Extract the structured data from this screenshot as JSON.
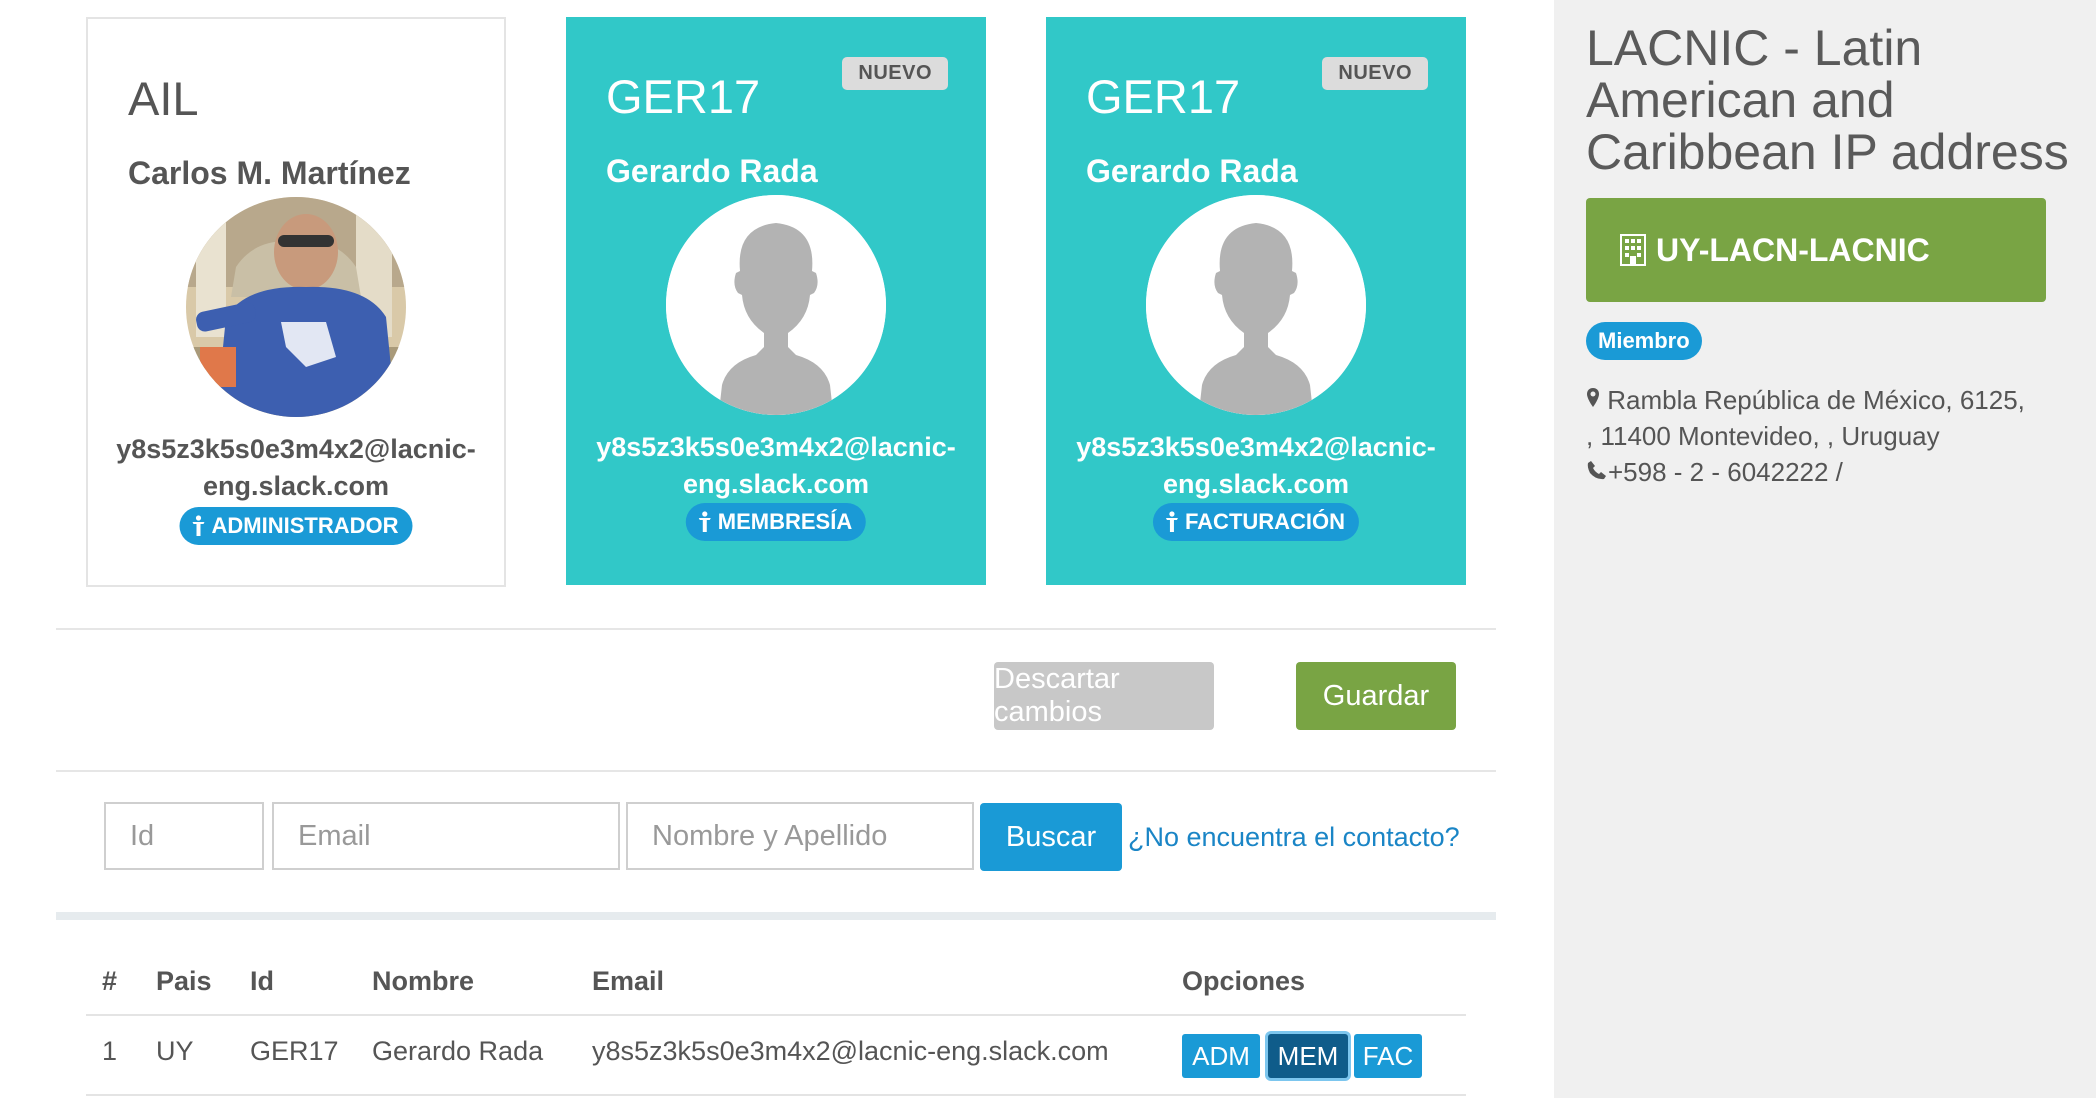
{
  "cards": [
    {
      "id": "AIL",
      "name": "Carlos M. Martínez",
      "email": "y8s5z3k5s0e3m4x2@lacnic-eng.slack.com",
      "role": "ADMINISTRADOR",
      "badge": ""
    },
    {
      "id": "GER17",
      "name": "Gerardo Rada",
      "email": "y8s5z3k5s0e3m4x2@lacnic-eng.slack.com",
      "role": "MEMBRESÍA",
      "badge": "NUEVO"
    },
    {
      "id": "GER17",
      "name": "Gerardo Rada",
      "email": "y8s5z3k5s0e3m4x2@lacnic-eng.slack.com",
      "role": "FACTURACIÓN",
      "badge": "NUEVO"
    }
  ],
  "actions": {
    "discard": "Descartar cambios",
    "save": "Guardar"
  },
  "search": {
    "id_placeholder": "Id",
    "email_placeholder": "Email",
    "name_placeholder": "Nombre y Apellido",
    "button": "Buscar",
    "not_found_link": "¿No encuentra el contacto?"
  },
  "table": {
    "headers": [
      "#",
      "Pais",
      "Id",
      "Nombre",
      "Email",
      "Opciones"
    ],
    "rows": [
      {
        "num": "1",
        "pais": "UY",
        "id": "GER17",
        "nombre": "Gerardo Rada",
        "email": "y8s5z3k5s0e3m4x2@lacnic-eng.slack.com",
        "options": [
          "ADM",
          "MEM",
          "FAC"
        ],
        "selected_option": "MEM"
      }
    ]
  },
  "sidebar": {
    "org_name": "LACNIC - Latin American and Caribbean IP address",
    "org_handle": "UY-LACN-LACNIC",
    "status": "Miembro",
    "address_line1": "Rambla República de México, 6125,",
    "address_line2": ", 11400 Montevideo, , Uruguay",
    "phone": "+598 - 2 - 6042222 /"
  },
  "colors": {
    "teal": "#31c8c8",
    "blue": "#1a9ad6",
    "green": "#79a444",
    "gray_button": "#c8c8c8"
  },
  "icons": [
    "person-icon",
    "map-marker-icon",
    "phone-icon",
    "building-icon"
  ]
}
